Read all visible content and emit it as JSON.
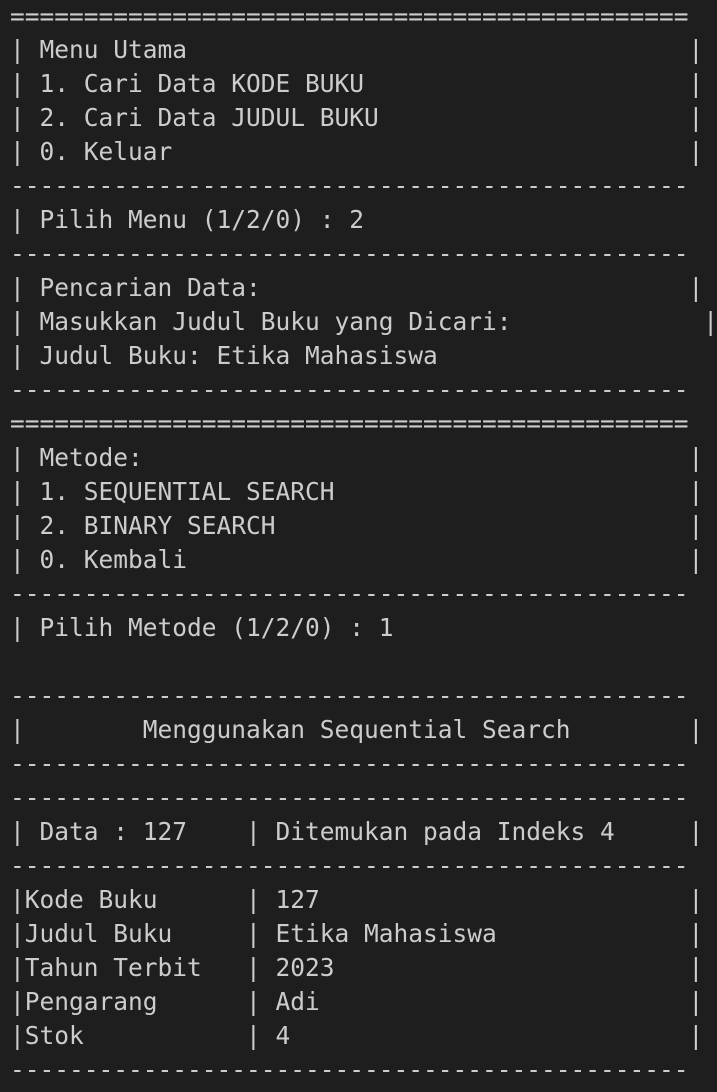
{
  "terminal": {
    "lines": [
      "==============================================",
      "| Menu Utama                                  |",
      "| 1. Cari Data KODE BUKU                      |",
      "| 2. Cari Data JUDUL BUKU                     |",
      "| 0. Keluar                                   |",
      "----------------------------------------------",
      "| Pilih Menu (1/2/0) : 2",
      "----------------------------------------------",
      "| Pencarian Data:                             |",
      "| Masukkan Judul Buku yang Dicari:             |",
      "| Judul Buku: Etika Mahasiswa",
      "----------------------------------------------",
      "==============================================",
      "| Metode:                                     |",
      "| 1. SEQUENTIAL SEARCH                        |",
      "| 2. BINARY SEARCH                            |",
      "| 0. Kembali                                  |",
      "----------------------------------------------",
      "| Pilih Metode (1/2/0) : 1",
      "",
      "----------------------------------------------",
      "|        Menggunakan Sequential Search        |",
      "----------------------------------------------",
      "----------------------------------------------",
      "| Data : 127    | Ditemukan pada Indeks 4     |",
      "----------------------------------------------",
      "|Kode Buku      | 127                         |",
      "|Judul Buku     | Etika Mahasiswa             |",
      "|Tahun Terbit   | 2023                        |",
      "|Pengarang      | Adi                         |",
      "|Stok           | 4                           |",
      "----------------------------------------------"
    ]
  }
}
